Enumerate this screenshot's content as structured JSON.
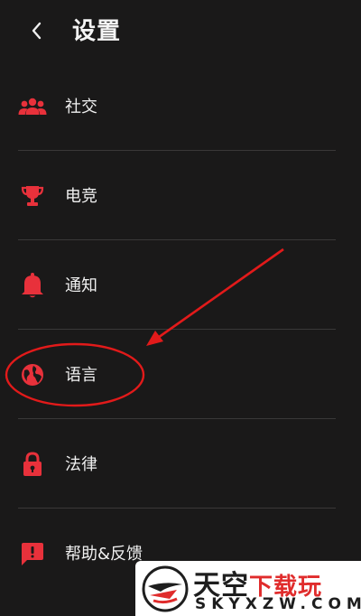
{
  "header": {
    "back_icon": "chevron-left-icon",
    "title": "设置"
  },
  "menu": {
    "items": [
      {
        "label": "社交",
        "icon": "people-group-icon"
      },
      {
        "label": "电竞",
        "icon": "trophy-icon"
      },
      {
        "label": "通知",
        "icon": "bell-icon"
      },
      {
        "label": "语言",
        "icon": "globe-icon"
      },
      {
        "label": "法律",
        "icon": "lock-icon"
      },
      {
        "label": "帮助&反馈",
        "icon": "feedback-icon"
      }
    ]
  },
  "colors": {
    "accent": "#e8313b",
    "annotation": "#e21a1a",
    "background": "#1a1919"
  },
  "watermark": {
    "title_part1": "天空",
    "title_part2": "下载玩",
    "url": "SKYXZW.COM"
  }
}
